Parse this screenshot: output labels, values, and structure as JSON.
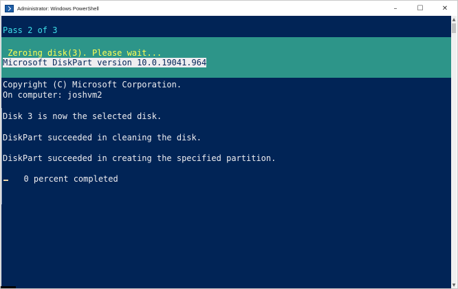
{
  "window": {
    "title": "Administrator: Windows PowerShell",
    "controls": {
      "minimize": "–",
      "maximize": "☐",
      "close": "✕"
    }
  },
  "console": {
    "pass_line": "Pass 2 of 3",
    "zeroing_line": " Zeroing disk(3). Please wait...",
    "diskpart_version": "Microsoft DiskPart version 10.0.19041.964",
    "copyright": "Copyright (C) Microsoft Corporation.",
    "computer": "On computer: joshvm2",
    "selected_disk": "Disk 3 is now the selected disk.",
    "clean_success": "DiskPart succeeded in cleaning the disk.",
    "partition_success": "DiskPart succeeded in creating the specified partition.",
    "progress": "  0 percent completed"
  },
  "scrollbar": {
    "up_arrow": "▲",
    "down_arrow": "▼"
  },
  "colors": {
    "console_bg": "#012456",
    "progress_band": "#2d9589",
    "cyan_text": "#3ee0e8",
    "yellow_text": "#ffff55",
    "text": "#eeedf0"
  }
}
